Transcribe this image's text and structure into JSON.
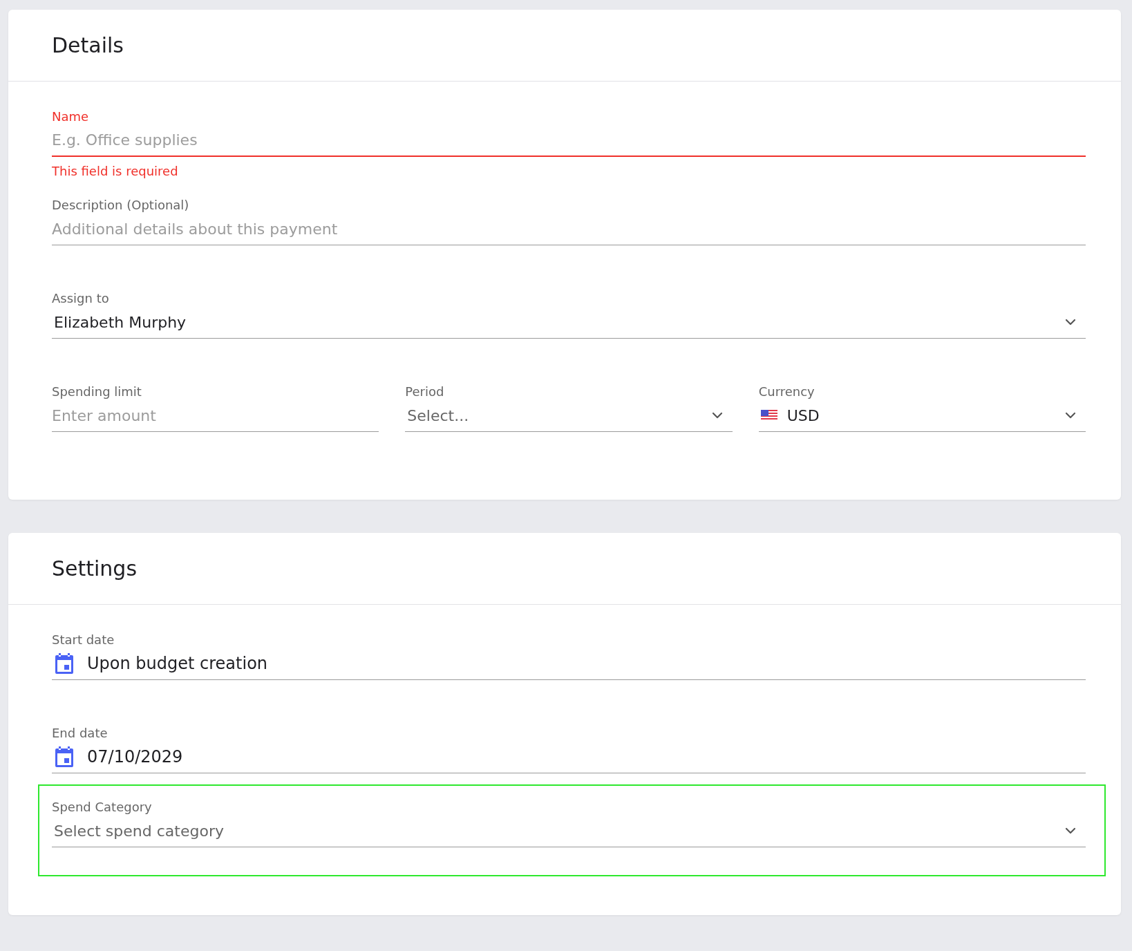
{
  "sections": [
    {
      "title": "Details",
      "rows": [
        [
          {
            "kind": "text",
            "label": "Name",
            "placeholder": "E.g. Office supplies",
            "invalid": true,
            "error": "This field is required",
            "highlighted": false
          }
        ],
        [
          {
            "kind": "text",
            "label": "Description (Optional)",
            "placeholder": "Additional details about this payment",
            "invalid": false,
            "highlighted": false
          }
        ],
        [
          {
            "kind": "select",
            "label": "Assign to",
            "value": "Elizabeth Murphy",
            "invalid": false,
            "highlighted": false
          }
        ],
        [
          {
            "kind": "text",
            "label": "Spending limit",
            "placeholder": "Enter amount",
            "invalid": false,
            "highlighted": false
          },
          {
            "kind": "select",
            "label": "Period",
            "placeholder": "Select...",
            "invalid": false,
            "highlighted": false
          },
          {
            "kind": "currency",
            "label": "Currency",
            "value": "USD",
            "invalid": false,
            "highlighted": false
          }
        ]
      ]
    },
    {
      "title": "Settings",
      "rows": [
        [
          {
            "kind": "date",
            "label": "Start date",
            "value": "Upon budget creation",
            "invalid": false,
            "highlighted": false
          }
        ],
        [
          {
            "kind": "date",
            "label": "End date",
            "value": "07/10/2029",
            "invalid": false,
            "highlighted": false
          }
        ],
        [
          {
            "kind": "select",
            "label": "Spend Category",
            "placeholder": "Select spend category",
            "invalid": false,
            "highlighted": true
          }
        ]
      ]
    }
  ]
}
